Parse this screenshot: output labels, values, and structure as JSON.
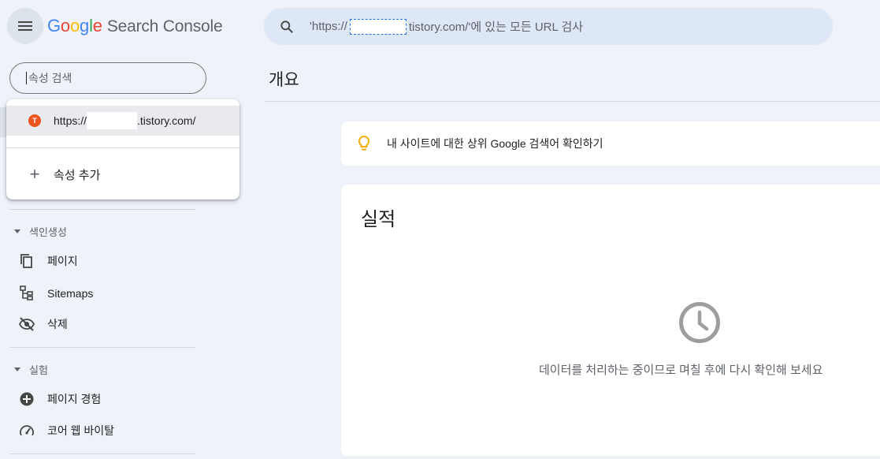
{
  "header": {
    "logo_google": "Google",
    "logo_product": "Search Console",
    "search_prefix": "'https://",
    "search_suffix": "tistory.com/'에 있는 모든 URL 검사"
  },
  "sidebar": {
    "property_search_placeholder": "속성 검색",
    "property_dropdown": {
      "items": [
        {
          "url_prefix": "https://",
          "url_suffix": ".tistory.com/"
        }
      ],
      "add_label": "속성 추가"
    },
    "sections": [
      {
        "title": "색인생성",
        "items": [
          {
            "label": "페이지",
            "icon": "pages-icon"
          },
          {
            "label": "Sitemaps",
            "icon": "sitemap-icon"
          },
          {
            "label": "삭제",
            "icon": "visibility-off-icon"
          }
        ]
      },
      {
        "title": "실험",
        "items": [
          {
            "label": "페이지 경험",
            "icon": "experience-icon"
          },
          {
            "label": "코어 웹 바이탈",
            "icon": "speedometer-icon"
          }
        ]
      }
    ]
  },
  "main": {
    "page_title": "개요",
    "tip_text": "내 사이트에 대한 상위 Google 검색어 확인하기",
    "performance": {
      "title": "실적",
      "processing_message": "데이터를 처리하는 중이므로 며칠 후에 다시 확인해 보세요"
    }
  },
  "colors": {
    "background": "#eff3f9",
    "search_bar": "#dde7f6",
    "tistory": "#eb531f",
    "bulb": "#f9ab00"
  }
}
